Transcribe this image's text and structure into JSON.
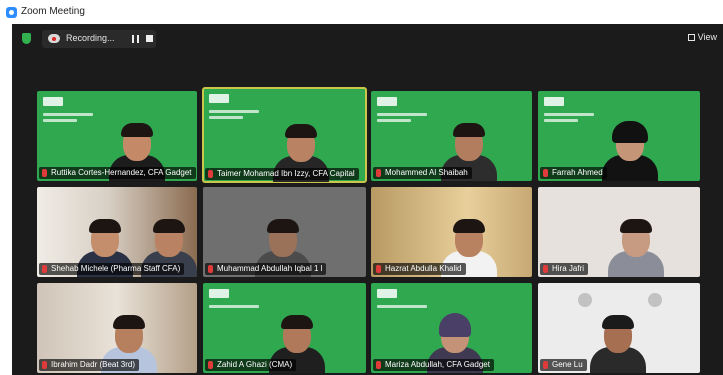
{
  "window": {
    "title": "Zoom Meeting"
  },
  "topbar": {
    "recording_label": "Recording...",
    "view_label": "View"
  },
  "colors": {
    "slide_green": "#2fa84f",
    "highlight": "#c9c64a"
  },
  "participants": [
    {
      "name": "Ruttika Cortes-Hernandez, CFA Gadget",
      "background": "green"
    },
    {
      "name": "Taimer Mohamad Ibn Izzy, CFA Capital",
      "background": "green",
      "active_speaker": true
    },
    {
      "name": "Mohammed Al Shaibah",
      "background": "green"
    },
    {
      "name": "Farrah Ahmed",
      "background": "green"
    },
    {
      "name": "Shehab Michele (Pharma Staff CFA)",
      "background": "office"
    },
    {
      "name": "Muhammad Abdullah Iqbal 1 l",
      "background": "gray"
    },
    {
      "name": "Hazrat Abdulla Khalid",
      "background": "warm"
    },
    {
      "name": "Hira Jafri",
      "background": "light"
    },
    {
      "name": "Ibrahim Dadr (Beat 3rd)",
      "background": "office"
    },
    {
      "name": "Zahid A Ghazi (CMA)",
      "background": "green"
    },
    {
      "name": "Mariza Abdullah, CFA Gadget",
      "background": "green"
    },
    {
      "name": "Gene Lu",
      "background": "banner"
    }
  ]
}
